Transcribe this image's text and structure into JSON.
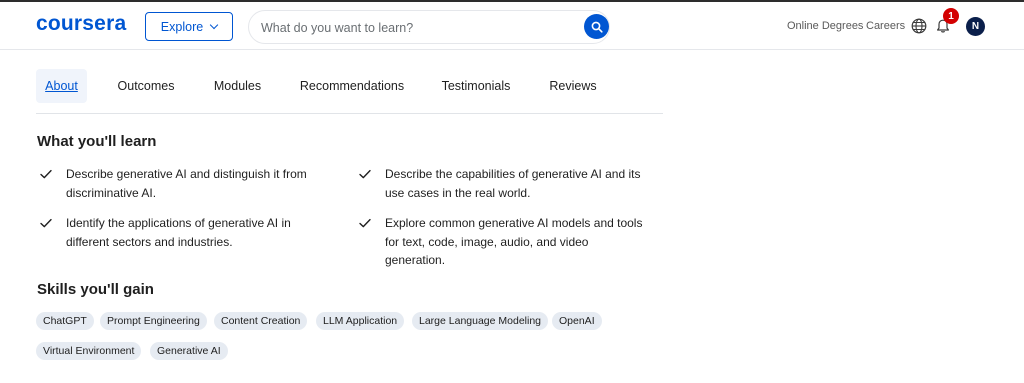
{
  "header": {
    "logo": "coursera",
    "explore_label": "Explore",
    "search_placeholder": "What do you want to learn?",
    "links": [
      "Online Degrees",
      "Careers"
    ],
    "notification_count": "1",
    "avatar_initial": "N",
    "colors": {
      "brand": "#0056d2",
      "badge": "#d30001",
      "avatar": "#0b1f4b"
    }
  },
  "tabs": [
    {
      "label": "About",
      "active": true
    },
    {
      "label": "Outcomes",
      "active": false
    },
    {
      "label": "Modules",
      "active": false
    },
    {
      "label": "Recommendations",
      "active": false
    },
    {
      "label": "Testimonials",
      "active": false
    },
    {
      "label": "Reviews",
      "active": false
    }
  ],
  "learn": {
    "title": "What you'll learn",
    "items": [
      "Describe generative AI and distinguish it from discriminative AI.",
      "Describe the capabilities of generative AI and its use cases in the real world.",
      "Identify the applications of generative AI in different sectors and industries.",
      "Explore common generative AI models and tools for text, code, image, audio, and video generation."
    ]
  },
  "skills": {
    "title": "Skills you'll gain",
    "items": [
      "ChatGPT",
      "Prompt Engineering",
      "Content Creation",
      "LLM Application",
      "Large Language Modeling",
      "OpenAI",
      "Virtual Environment",
      "Generative AI"
    ]
  }
}
